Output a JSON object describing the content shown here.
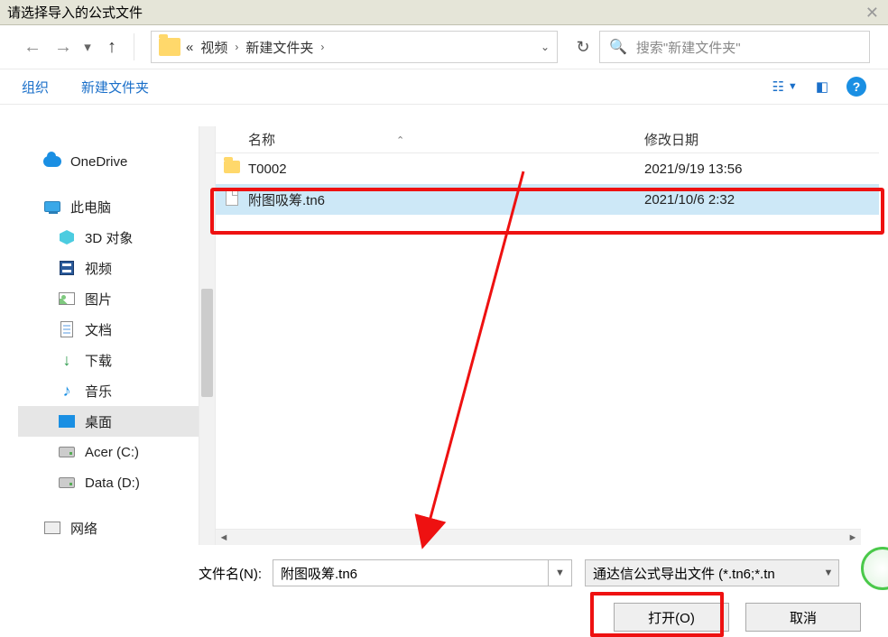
{
  "window": {
    "title": "请选择导入的公式文件"
  },
  "nav": {
    "crumb_prefix": "«",
    "crumb1": "视频",
    "crumb2": "新建文件夹",
    "search_placeholder": "搜索\"新建文件夹\""
  },
  "toolbar": {
    "organize": "组织",
    "newfolder": "新建文件夹"
  },
  "sidebar": {
    "items": [
      {
        "label": "OneDrive",
        "icon": "cloud",
        "lvl": 1
      },
      {
        "label": "此电脑",
        "icon": "pc",
        "lvl": 1
      },
      {
        "label": "3D 对象",
        "icon": "cube",
        "lvl": 2
      },
      {
        "label": "视频",
        "icon": "film",
        "lvl": 2
      },
      {
        "label": "图片",
        "icon": "img",
        "lvl": 2
      },
      {
        "label": "文档",
        "icon": "doc",
        "lvl": 2
      },
      {
        "label": "下载",
        "icon": "dl",
        "lvl": 2
      },
      {
        "label": "音乐",
        "icon": "note",
        "lvl": 2
      },
      {
        "label": "桌面",
        "icon": "desk",
        "lvl": 2,
        "sel": true
      },
      {
        "label": "Acer (C:)",
        "icon": "drive",
        "lvl": 2
      },
      {
        "label": "Data (D:)",
        "icon": "drive",
        "lvl": 2
      },
      {
        "label": "网络",
        "icon": "net",
        "lvl": 1
      }
    ]
  },
  "files": {
    "col_name": "名称",
    "col_date": "修改日期",
    "rows": [
      {
        "type": "folder",
        "name": "T0002",
        "date": "2021/9/19 13:56"
      },
      {
        "type": "file",
        "name": "附图吸筹.tn6",
        "date": "2021/10/6 2:32",
        "sel": true
      }
    ]
  },
  "bottom": {
    "filename_label": "文件名(N):",
    "filename_value": "附图吸筹.tn6",
    "filter_text": "通达信公式导出文件 (*.tn6;*.tn",
    "open_btn": "打开(O)",
    "cancel_btn": "取消"
  }
}
